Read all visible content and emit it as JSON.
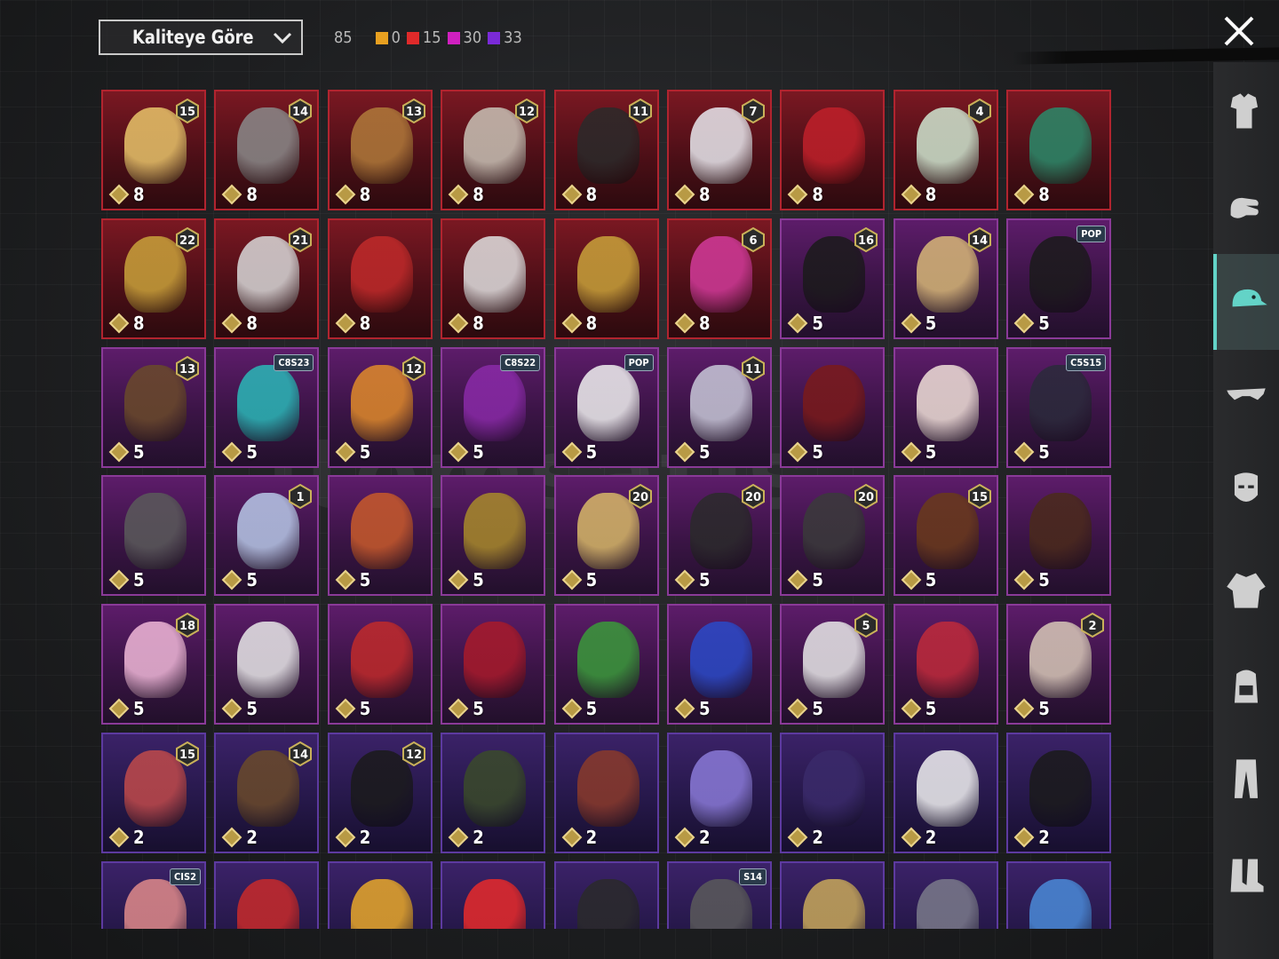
{
  "header": {
    "sort_label": "Kaliteye Göre",
    "total": "85",
    "rarity_counts": [
      {
        "color": "#e8a020",
        "value": "0"
      },
      {
        "color": "#e02a2a",
        "value": "15"
      },
      {
        "color": "#d020c0",
        "value": "30"
      },
      {
        "color": "#7a2ad8",
        "value": "33"
      }
    ]
  },
  "watermark": "itemsatis",
  "sidebar": {
    "items": [
      {
        "icon": "outfit-icon"
      },
      {
        "icon": "glove-icon"
      },
      {
        "icon": "cap-icon",
        "active": true
      },
      {
        "icon": "glasses-icon"
      },
      {
        "icon": "mask-icon"
      },
      {
        "icon": "jacket-icon"
      },
      {
        "icon": "backpack-icon"
      },
      {
        "icon": "pants-icon"
      },
      {
        "icon": "boots-icon"
      }
    ]
  },
  "items": [
    {
      "rarity": "red",
      "count": "8",
      "tag": "15",
      "art": "#e8c46a"
    },
    {
      "rarity": "red",
      "count": "8",
      "tag": "14",
      "art": "#8a8a8a"
    },
    {
      "rarity": "red",
      "count": "8",
      "tag": "13",
      "art": "#b07a3a"
    },
    {
      "rarity": "red",
      "count": "8",
      "tag": "12",
      "art": "#c9c2b6"
    },
    {
      "rarity": "red",
      "count": "8",
      "tag": "11",
      "art": "#2a2a2a"
    },
    {
      "rarity": "red",
      "count": "8",
      "tag": "7",
      "art": "#e8e8ee"
    },
    {
      "rarity": "red",
      "count": "8",
      "tag": "",
      "art": "#c0202a"
    },
    {
      "rarity": "red",
      "count": "8",
      "tag": "4",
      "art": "#cfe6d0"
    },
    {
      "rarity": "red",
      "count": "8",
      "tag": "",
      "art": "#2a8a6a"
    },
    {
      "rarity": "red",
      "count": "8",
      "tag": "22",
      "art": "#c9a23a"
    },
    {
      "rarity": "red",
      "count": "8",
      "tag": "21",
      "art": "#d8d8d8"
    },
    {
      "rarity": "red",
      "count": "8",
      "tag": "",
      "art": "#c02a2a"
    },
    {
      "rarity": "red",
      "count": "8",
      "tag": "",
      "art": "#e0e0e0"
    },
    {
      "rarity": "red",
      "count": "8",
      "tag": "",
      "art": "#c9a23a"
    },
    {
      "rarity": "red",
      "count": "8",
      "tag": "6",
      "art": "#d23a9a"
    },
    {
      "rarity": "purple",
      "count": "5",
      "tag": "16",
      "art": "#1a1a1a"
    },
    {
      "rarity": "purple",
      "count": "5",
      "tag": "14",
      "art": "#d8b878"
    },
    {
      "rarity": "purple",
      "count": "5",
      "label": "POP",
      "art": "#1a1a1a"
    },
    {
      "rarity": "purple",
      "count": "5",
      "tag": "13",
      "art": "#6a4a2a"
    },
    {
      "rarity": "purple",
      "count": "5",
      "label": "C8S23",
      "art": "#2ab8b8"
    },
    {
      "rarity": "purple",
      "count": "5",
      "tag": "12",
      "art": "#e08a2a"
    },
    {
      "rarity": "purple",
      "count": "5",
      "label": "C8S22",
      "art": "#8a2aa8"
    },
    {
      "rarity": "purple",
      "count": "5",
      "label": "POP",
      "art": "#f0f0f0"
    },
    {
      "rarity": "purple",
      "count": "5",
      "tag": "11",
      "art": "#c8c8d8"
    },
    {
      "rarity": "purple",
      "count": "5",
      "tag": "",
      "art": "#7a1a1a"
    },
    {
      "rarity": "purple",
      "count": "5",
      "tag": "",
      "art": "#f0e0d8"
    },
    {
      "rarity": "purple",
      "count": "5",
      "label": "C5S15",
      "art": "#2a2a3a"
    },
    {
      "rarity": "purple",
      "count": "5",
      "tag": "",
      "art": "#5a5a5a"
    },
    {
      "rarity": "purple",
      "count": "5",
      "tag": "1",
      "art": "#b8c8e8"
    },
    {
      "rarity": "purple",
      "count": "5",
      "tag": "",
      "art": "#c85a2a"
    },
    {
      "rarity": "purple",
      "count": "5",
      "tag": "",
      "art": "#a88a2a"
    },
    {
      "rarity": "purple",
      "count": "5",
      "tag": "20",
      "art": "#d8b868"
    },
    {
      "rarity": "purple",
      "count": "5",
      "tag": "20",
      "art": "#2a2a2a"
    },
    {
      "rarity": "purple",
      "count": "5",
      "tag": "20",
      "art": "#3a3a3a"
    },
    {
      "rarity": "purple",
      "count": "5",
      "tag": "15",
      "art": "#6a3a1a"
    },
    {
      "rarity": "purple",
      "count": "5",
      "tag": "",
      "art": "#4a2a1a"
    },
    {
      "rarity": "purple",
      "count": "5",
      "tag": "18",
      "art": "#f0b8d8"
    },
    {
      "rarity": "purple",
      "count": "5",
      "tag": "",
      "art": "#e8e8e8"
    },
    {
      "rarity": "purple",
      "count": "5",
      "tag": "",
      "art": "#c02a2a"
    },
    {
      "rarity": "purple",
      "count": "5",
      "tag": "",
      "art": "#a81a2a"
    },
    {
      "rarity": "purple",
      "count": "5",
      "tag": "",
      "art": "#3a9a3a"
    },
    {
      "rarity": "purple",
      "count": "5",
      "tag": "",
      "art": "#2a4ac8"
    },
    {
      "rarity": "purple",
      "count": "5",
      "tag": "5",
      "art": "#e8e8e8"
    },
    {
      "rarity": "purple",
      "count": "5",
      "tag": "",
      "art": "#c02a3a"
    },
    {
      "rarity": "purple",
      "count": "5",
      "tag": "2",
      "art": "#d8c8b8"
    },
    {
      "rarity": "violet",
      "count": "2",
      "tag": "15",
      "art": "#c04a4a"
    },
    {
      "rarity": "violet",
      "count": "2",
      "tag": "14",
      "art": "#6a4a2a"
    },
    {
      "rarity": "violet",
      "count": "2",
      "tag": "12",
      "art": "#1a1a1a"
    },
    {
      "rarity": "violet",
      "count": "2",
      "tag": "",
      "art": "#3a4a2a"
    },
    {
      "rarity": "violet",
      "count": "2",
      "tag": "",
      "art": "#8a3a2a"
    },
    {
      "rarity": "violet",
      "count": "2",
      "tag": "",
      "art": "#8a7ad8"
    },
    {
      "rarity": "violet",
      "count": "2",
      "tag": "",
      "art": "#3a2a6a"
    },
    {
      "rarity": "violet",
      "count": "2",
      "tag": "",
      "art": "#f0f0f0"
    },
    {
      "rarity": "violet",
      "count": "2",
      "tag": "",
      "art": "#1a1a1a"
    },
    {
      "rarity": "violet",
      "count": "",
      "label": "CIS2",
      "art": "#e08a8a"
    },
    {
      "rarity": "violet",
      "count": "",
      "tag": "",
      "art": "#c82a2a"
    },
    {
      "rarity": "violet",
      "count": "",
      "tag": "",
      "art": "#e8a82a"
    },
    {
      "rarity": "violet",
      "count": "",
      "tag": "",
      "art": "#e82a2a"
    },
    {
      "rarity": "violet",
      "count": "",
      "tag": "",
      "art": "#2a2a2a"
    },
    {
      "rarity": "violet",
      "count": "",
      "label": "S14",
      "art": "#5a5a5a"
    },
    {
      "rarity": "violet",
      "count": "",
      "tag": "",
      "art": "#c8a85a"
    },
    {
      "rarity": "violet",
      "count": "",
      "tag": "",
      "art": "#7a7a8a"
    },
    {
      "rarity": "violet",
      "count": "",
      "tag": "",
      "art": "#4a8ad8"
    }
  ]
}
